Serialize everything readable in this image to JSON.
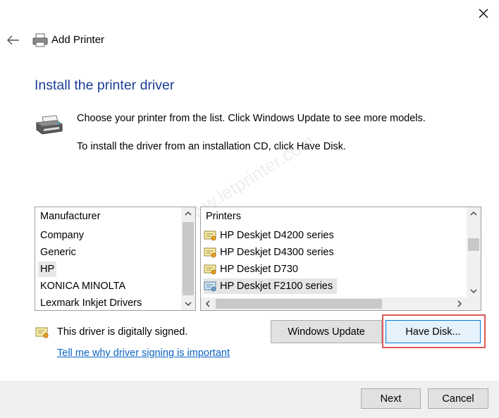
{
  "header": {
    "window_title": "Add Printer",
    "page_title": "Install the printer driver"
  },
  "instructions": {
    "line1": "Choose your printer from the list. Click Windows Update to see more models.",
    "line2": "To install the driver from an installation CD, click Have Disk."
  },
  "manufacturer_list": {
    "header": "Manufacturer",
    "items": [
      "Company",
      "Generic",
      "HP",
      "KONICA MINOLTA",
      "Lexmark Inkjet Drivers"
    ],
    "selected": "HP"
  },
  "printer_list": {
    "header": "Printers",
    "items": [
      "HP Deskjet D4200 series",
      "HP Deskjet D4300 series",
      "HP Deskjet D730",
      "HP Deskjet F2100 series"
    ],
    "selected": "HP Deskjet F2100 series"
  },
  "signing": {
    "status": "This driver is digitally signed.",
    "link": "Tell me why driver signing is important"
  },
  "buttons": {
    "windows_update": "Windows Update",
    "have_disk": "Have Disk...",
    "next": "Next",
    "cancel": "Cancel"
  },
  "watermark": "www.letprinter.com",
  "colors": {
    "title_blue": "#1b3e94",
    "link_blue": "#0b62c4",
    "highlight_red": "#e05858",
    "default_button_border": "#0078d7"
  },
  "icons": [
    "close-icon",
    "back-arrow-icon",
    "printer-icon",
    "certificate-icon",
    "chevron-up-icon",
    "chevron-down-icon",
    "chevron-left-icon",
    "chevron-right-icon"
  ]
}
